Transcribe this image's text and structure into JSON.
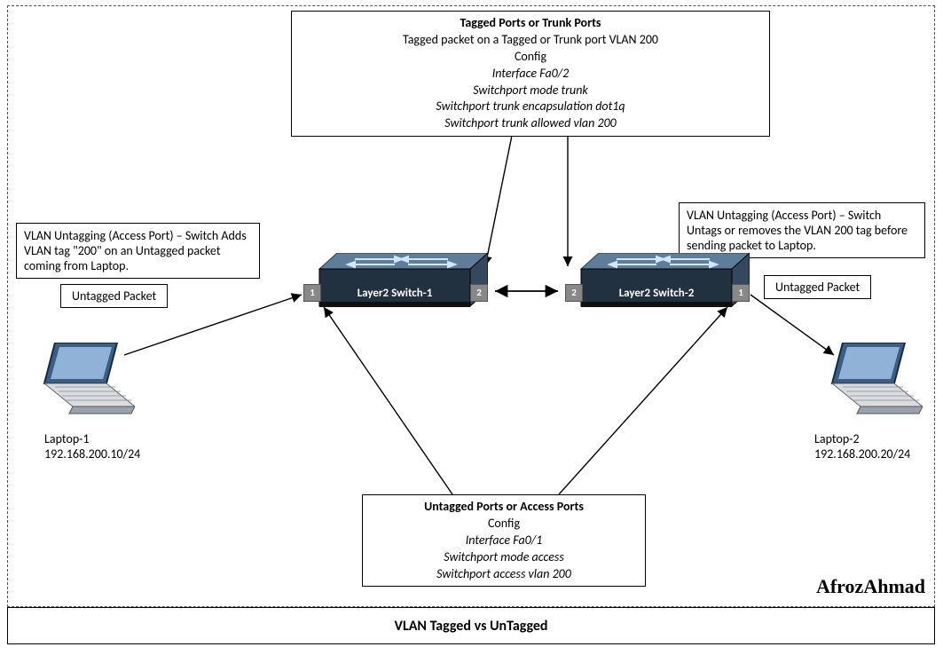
{
  "caption": "VLAN Tagged vs UnTagged",
  "signature": "AfrozAhmad",
  "top_box": {
    "title": "Tagged Ports or Trunk Ports",
    "line1": "Tagged packet on a Tagged or Trunk port  VLAN 200",
    "line2": "Config",
    "line3": "Interface Fa0/2",
    "line4": "Switchport mode trunk",
    "line5": "Switchport trunk encapsulation dot1q",
    "line6": "Switchport trunk allowed vlan 200"
  },
  "bottom_box": {
    "title": "Untagged Ports or Access Ports",
    "line1": "Config",
    "line2": "Interface Fa0/1",
    "line3": "Switchport mode access",
    "line4": "Switchport access vlan 200"
  },
  "left_desc": "VLAN Untagging (Access Port) – Switch Adds VLAN tag \"200\" on an Untagged packet coming from Laptop.",
  "right_desc": "VLAN Untagging (Access Port) – Switch Untags or removes the VLAN 200 tag before sending packet to Laptop.",
  "untagged_label_left": "Untagged Packet",
  "untagged_label_right": "Untagged Packet",
  "switch1": {
    "label": "Layer2 Switch-1",
    "port1": "1",
    "port2": "2"
  },
  "switch2": {
    "label": "Layer2 Switch-2",
    "port1": "1",
    "port2": "2"
  },
  "laptop1": {
    "name": "Laptop-1",
    "ip": "192.168.200.10/24"
  },
  "laptop2": {
    "name": "Laptop-2",
    "ip": "192.168.200.20/24"
  }
}
